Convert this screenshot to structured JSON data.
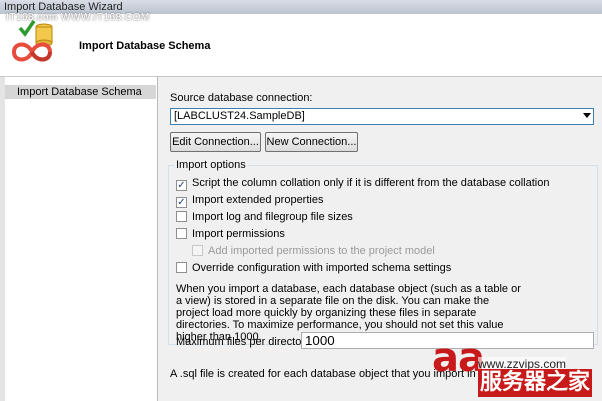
{
  "window": {
    "title": "Import Database Wizard",
    "top_watermark": "IT168.com   WWW.IT168.COM"
  },
  "header": {
    "title": "Import Database Schema"
  },
  "sidebar": {
    "items": [
      {
        "label": "Import Database Schema",
        "selected": true
      }
    ]
  },
  "source": {
    "label": "Source database connection:",
    "value": "[LABCLUST24.SampleDB]",
    "edit_button": "Edit Connection...",
    "new_button": "New Connection..."
  },
  "import_options": {
    "title": "Import options",
    "options": [
      {
        "label": "Script the column collation only if it is different from the database collation",
        "checked": true,
        "enabled": true
      },
      {
        "label": "Import extended properties",
        "checked": true,
        "enabled": true
      },
      {
        "label": "Import log and filegroup file sizes",
        "checked": false,
        "enabled": true
      },
      {
        "label": "Import permissions",
        "checked": false,
        "enabled": true
      },
      {
        "label": "Add imported permissions to the project model",
        "checked": false,
        "enabled": false
      },
      {
        "label": "Override configuration with imported schema settings",
        "checked": false,
        "enabled": true
      }
    ],
    "description": "When you import a database, each database object (such as a table or a view) is stored in a separate file on the disk. You can make the project load more quickly by organizing these files in separate directories. To maximize performance, you should not set this value higher than 1000.",
    "max_files_label": "Maximum files per directory:",
    "max_files_value": "1000"
  },
  "footer_note": "A .sql file is created for each database object that you import in",
  "watermark": {
    "brand": "aa",
    "url": "www.zzvips.com",
    "cn": "服务器之家"
  },
  "colors": {
    "accent_border": "#3c7fb1",
    "watermark_red": "#c81a1a"
  }
}
